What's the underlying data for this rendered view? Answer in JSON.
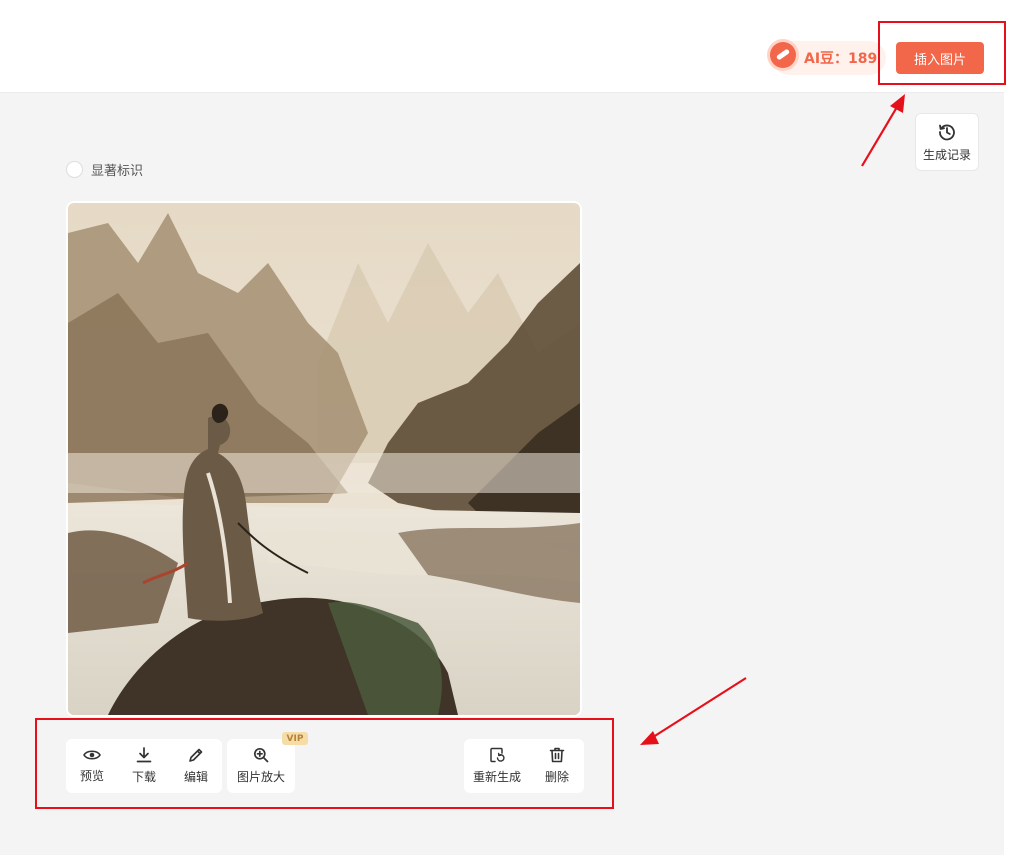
{
  "header": {
    "credits_label": "AI豆：189",
    "insert_button_label": "插入图片"
  },
  "sidebar": {
    "history_button_label": "生成记录"
  },
  "options": {
    "watermark_label": "显著标识"
  },
  "image": {
    "subject": "ink-wash painting of a robed scholar standing on a rock overlooking misty mountains and a river"
  },
  "toolbar": {
    "preview_label": "预览",
    "download_label": "下载",
    "edit_label": "编辑",
    "upscale_label": "图片放大",
    "vip_badge": "VIP",
    "regenerate_label": "重新生成",
    "delete_label": "删除"
  },
  "colors": {
    "accent": "#f2664a",
    "annotation": "#e5101a",
    "vip_bg": "#f6dda8"
  }
}
